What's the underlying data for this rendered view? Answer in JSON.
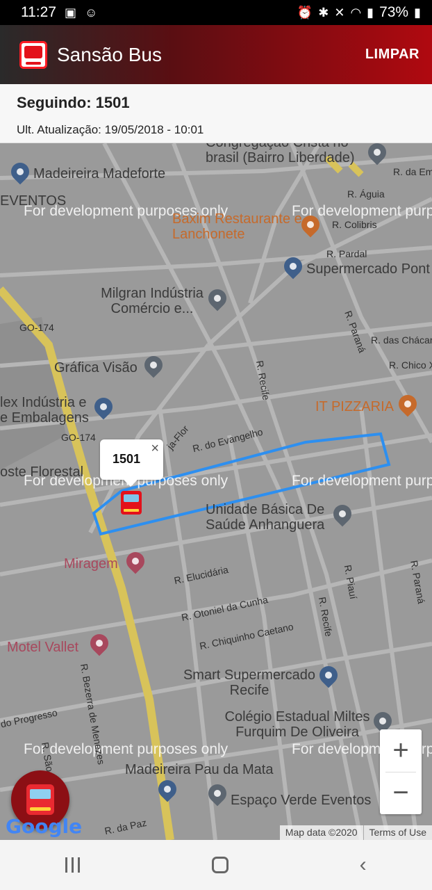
{
  "status_bar": {
    "time": "11:27",
    "battery": "73%",
    "icons": [
      "image-icon",
      "assistant-icon",
      "alarm-icon",
      "bluetooth-icon",
      "mute-icon",
      "wifi-icon",
      "signal-icon",
      "battery-icon"
    ]
  },
  "app_bar": {
    "title": "Sansão Bus",
    "action_label": "LIMPAR",
    "brand_color": "#b00910"
  },
  "tracking": {
    "title": "Seguindo: 1501",
    "last_update": "Ult. Atualização: 19/05/2018 - 10:01"
  },
  "map": {
    "watermark": "For development purposes only",
    "places": [
      "Congregação Cristã no brasil (Bairro Liberdade)",
      "Madeireira Madeforte",
      "EVENTOS",
      "Baxim Restaurante e Lanchonete",
      "Supermercado Pont",
      "Milgran Indústria Comércio e...",
      "Gráfica Visão",
      "lex Indústria e e Embalagens",
      "IT PIZZARIA",
      "oste Florestal",
      "Unidade Básica De Saúde Anhanguera",
      "Miragem",
      "Motel Vallet",
      "Smart Supermercado Recife",
      "Colégio Estadual Miltes Furquim De Oliveira",
      "Madeireira Pau da Mata",
      "Espaço Verde Eventos"
    ],
    "streets": [
      "R. da Em",
      "R. Águia",
      "R. Colibris",
      "R. Pardal",
      "GO-174",
      "R. Paraná",
      "R. das Chácar",
      "R. Chico Xav",
      "R. Recife",
      "R. do Evangelho",
      "ja-Flor",
      "R. Piauí",
      "R. Elucidária",
      "R. Otoniel da Cunha",
      "R. Chiquinho Caetano",
      "R. Bezerra de Menezes",
      "do Progresso",
      "R. São Fr",
      "R. da Paz"
    ],
    "route_color": "#2d8ff0",
    "bus_popup_label": "1501",
    "zoom_in": "+",
    "zoom_out": "−",
    "google": "Google",
    "attribution_data": "Map data ©2020",
    "attribution_terms": "Terms of Use"
  },
  "nav_bar": {
    "back": "‹"
  }
}
